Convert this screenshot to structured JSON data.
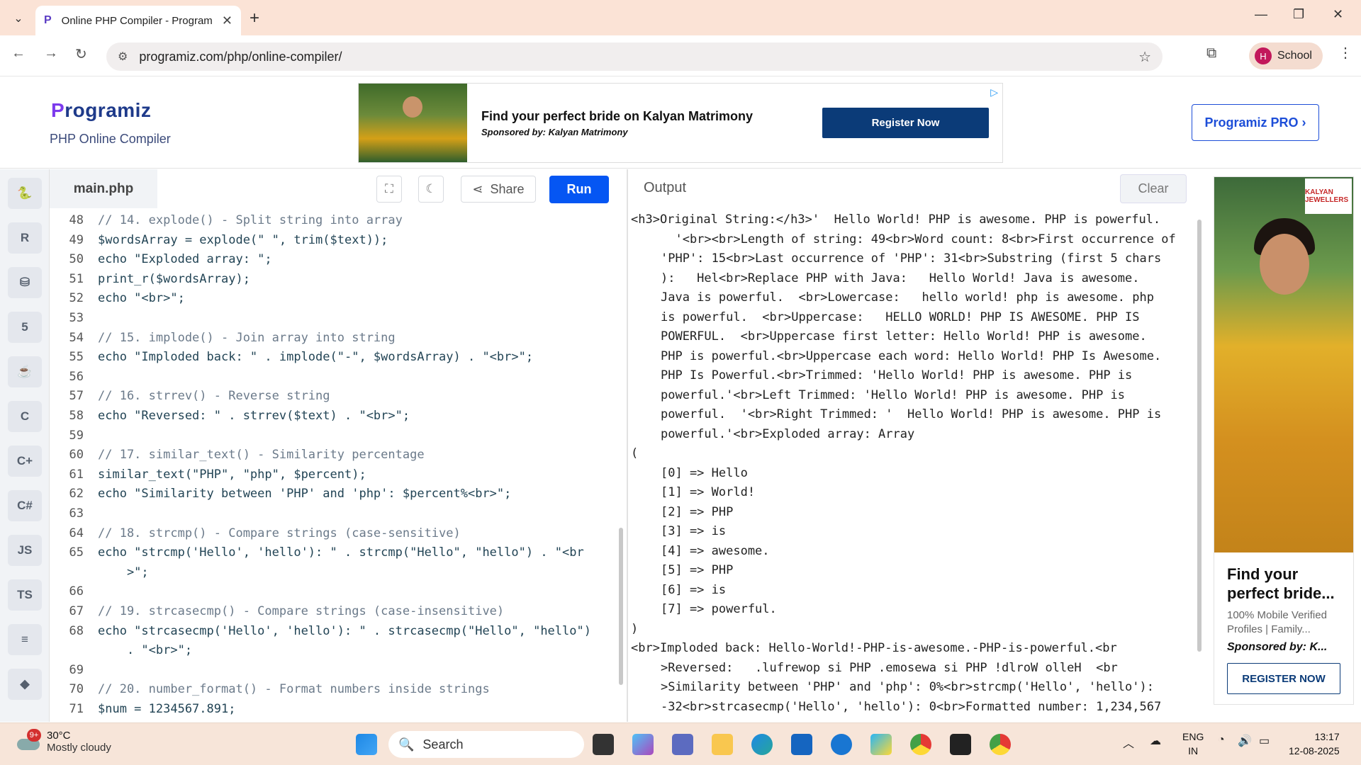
{
  "browser": {
    "tab_title": "Online PHP Compiler - Program",
    "url": "programiz.com/php/online-compiler/",
    "profile_initial": "H",
    "profile_name": "School"
  },
  "header": {
    "logo_text": "rogramiz",
    "logo_p": "P",
    "subtitle": "PHP Online Compiler",
    "pro_button": "Programiz PRO ›"
  },
  "ad_banner": {
    "title": "Find your perfect bride on Kalyan Matrimony",
    "sponsor": "Sponsored by: Kalyan Matrimony",
    "button": "Register Now"
  },
  "rail": [
    "python",
    "R",
    "sql",
    "html",
    "java",
    "C",
    "C++",
    "C#",
    "JS",
    "TS",
    "go",
    "swift"
  ],
  "editor": {
    "file_name": "main.php",
    "share_label": "Share",
    "run_label": "Run",
    "lines": [
      {
        "n": "48",
        "t": "// 14. explode() - Split string into array",
        "k": "cm"
      },
      {
        "n": "49",
        "t": "$wordsArray = explode(\" \", trim($text));",
        "k": "code"
      },
      {
        "n": "50",
        "t": "echo \"Exploded array: \";",
        "k": "code"
      },
      {
        "n": "51",
        "t": "print_r($wordsArray);",
        "k": "code"
      },
      {
        "n": "52",
        "t": "echo \"<br>\";",
        "k": "code"
      },
      {
        "n": "53",
        "t": "",
        "k": "code"
      },
      {
        "n": "54",
        "t": "// 15. implode() - Join array into string",
        "k": "cm"
      },
      {
        "n": "55",
        "t": "echo \"Imploded back: \" . implode(\"-\", $wordsArray) . \"<br>\";",
        "k": "code"
      },
      {
        "n": "56",
        "t": "",
        "k": "code"
      },
      {
        "n": "57",
        "t": "// 16. strrev() - Reverse string",
        "k": "cm"
      },
      {
        "n": "58",
        "t": "echo \"Reversed: \" . strrev($text) . \"<br>\";",
        "k": "code"
      },
      {
        "n": "59",
        "t": "",
        "k": "code"
      },
      {
        "n": "60",
        "t": "// 17. similar_text() - Similarity percentage",
        "k": "cm"
      },
      {
        "n": "61",
        "t": "similar_text(\"PHP\", \"php\", $percent);",
        "k": "code"
      },
      {
        "n": "62",
        "t": "echo \"Similarity between 'PHP' and 'php': $percent%<br>\";",
        "k": "code"
      },
      {
        "n": "63",
        "t": "",
        "k": "code"
      },
      {
        "n": "64",
        "t": "// 18. strcmp() - Compare strings (case-sensitive)",
        "k": "cm"
      },
      {
        "n": "65",
        "t": "echo \"strcmp('Hello', 'hello'): \" . strcmp(\"Hello\", \"hello\") . \"<br",
        "k": "code"
      },
      {
        "n": "",
        "t": "    >\";",
        "k": "code"
      },
      {
        "n": "66",
        "t": "",
        "k": "code"
      },
      {
        "n": "67",
        "t": "// 19. strcasecmp() - Compare strings (case-insensitive)",
        "k": "cm"
      },
      {
        "n": "68",
        "t": "echo \"strcasecmp('Hello', 'hello'): \" . strcasecmp(\"Hello\", \"hello\")",
        "k": "code"
      },
      {
        "n": "",
        "t": "    . \"<br>\";",
        "k": "code"
      },
      {
        "n": "69",
        "t": "",
        "k": "code"
      },
      {
        "n": "70",
        "t": "// 20. number_format() - Format numbers inside strings",
        "k": "cm"
      },
      {
        "n": "71",
        "t": "$num = 1234567.891;",
        "k": "code"
      }
    ]
  },
  "output": {
    "title": "Output",
    "clear_label": "Clear",
    "lines": [
      {
        "i": 0,
        "t": "<h3>Original String:</h3>'  Hello World! PHP is awesome. PHP is powerful."
      },
      {
        "i": 2,
        "t": "  '<br><br>Length of string: 49<br>Word count: 8<br>First occurrence of"
      },
      {
        "i": 2,
        "t": "'PHP': 15<br>Last occurrence of 'PHP': 31<br>Substring (first 5 chars"
      },
      {
        "i": 2,
        "t": "):   Hel<br>Replace PHP with Java:   Hello World! Java is awesome."
      },
      {
        "i": 2,
        "t": "Java is powerful.  <br>Lowercase:   hello world! php is awesome. php"
      },
      {
        "i": 2,
        "t": "is powerful.  <br>Uppercase:   HELLO WORLD! PHP IS AWESOME. PHP IS"
      },
      {
        "i": 2,
        "t": "POWERFUL.  <br>Uppercase first letter: Hello World! PHP is awesome."
      },
      {
        "i": 2,
        "t": "PHP is powerful.<br>Uppercase each word: Hello World! PHP Is Awesome."
      },
      {
        "i": 2,
        "t": "PHP Is Powerful.<br>Trimmed: 'Hello World! PHP is awesome. PHP is"
      },
      {
        "i": 2,
        "t": "powerful.'<br>Left Trimmed: 'Hello World! PHP is awesome. PHP is"
      },
      {
        "i": 2,
        "t": "powerful.  '<br>Right Trimmed: '  Hello World! PHP is awesome. PHP is"
      },
      {
        "i": 2,
        "t": "powerful.'<br>Exploded array: Array"
      },
      {
        "i": 0,
        "t": "("
      },
      {
        "i": 2,
        "t": "[0] => Hello"
      },
      {
        "i": 2,
        "t": "[1] => World!"
      },
      {
        "i": 2,
        "t": "[2] => PHP"
      },
      {
        "i": 2,
        "t": "[3] => is"
      },
      {
        "i": 2,
        "t": "[4] => awesome."
      },
      {
        "i": 2,
        "t": "[5] => PHP"
      },
      {
        "i": 2,
        "t": "[6] => is"
      },
      {
        "i": 2,
        "t": "[7] => powerful."
      },
      {
        "i": 0,
        "t": ")"
      },
      {
        "i": 0,
        "t": "<br>Imploded back: Hello-World!-PHP-is-awesome.-PHP-is-powerful.<br"
      },
      {
        "i": 2,
        "t": ">Reversed:   .lufrewop si PHP .emosewa si PHP !dlroW olleH  <br"
      },
      {
        "i": 2,
        "t": ">Similarity between 'PHP' and 'php': 0%<br>strcmp('Hello', 'hello'):"
      },
      {
        "i": 2,
        "t": "-32<br>strcasecmp('Hello', 'hello'): 0<br>Formatted number: 1,234,567"
      }
    ]
  },
  "side_ad": {
    "brand": "KALYAN JEWELLERS",
    "title": "Find your perfect bride...",
    "text": "100% Mobile Verified Profiles | Family...",
    "sponsor": "Sponsored by: K...",
    "button": "REGISTER NOW"
  },
  "taskbar": {
    "weather_badge": "9+",
    "temperature": "30°C",
    "condition": "Mostly cloudy",
    "search": "Search",
    "lang1": "ENG",
    "lang2": "IN",
    "time": "13:17",
    "date": "12-08-2025"
  }
}
